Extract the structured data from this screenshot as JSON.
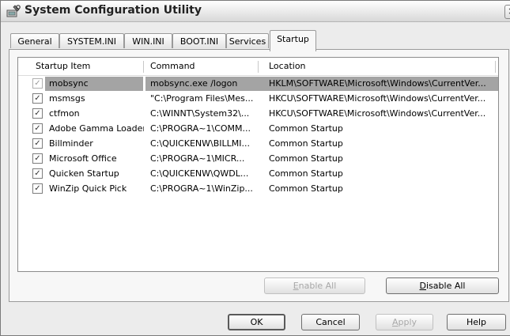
{
  "window": {
    "title": "System Configuration Utility",
    "close_glyph": "×",
    "icon": "config-utility-icon"
  },
  "tabs": [
    {
      "label": "General",
      "active": false
    },
    {
      "label": "SYSTEM.INI",
      "active": false
    },
    {
      "label": "WIN.INI",
      "active": false
    },
    {
      "label": "BOOT.INI",
      "active": false
    },
    {
      "label": "Services",
      "active": false
    },
    {
      "label": "Startup",
      "active": true
    }
  ],
  "list": {
    "columns": [
      "Startup Item",
      "Command",
      "Location"
    ],
    "rows": [
      {
        "item": "mobsync",
        "command": "mobsync.exe /logon",
        "location": "HKLM\\SOFTWARE\\Microsoft\\Windows\\CurrentVer...",
        "checked": true,
        "selected": true
      },
      {
        "item": "msmsgs",
        "command": "\"C:\\Program Files\\Mes...",
        "location": "HKCU\\SOFTWARE\\Microsoft\\Windows\\CurrentVer...",
        "checked": true,
        "selected": false
      },
      {
        "item": "ctfmon",
        "command": "C:\\WINNT\\System32\\...",
        "location": "HKCU\\SOFTWARE\\Microsoft\\Windows\\CurrentVer...",
        "checked": true,
        "selected": false
      },
      {
        "item": "Adobe Gamma Loader",
        "command": "C:\\PROGRA~1\\COMM...",
        "location": "Common Startup",
        "checked": true,
        "selected": false
      },
      {
        "item": "Billminder",
        "command": "C:\\QUICKENW\\BILLMI...",
        "location": "Common Startup",
        "checked": true,
        "selected": false
      },
      {
        "item": "Microsoft Office",
        "command": "C:\\PROGRA~1\\MICR...",
        "location": "Common Startup",
        "checked": true,
        "selected": false
      },
      {
        "item": "Quicken Startup",
        "command": "C:\\QUICKENW\\QWDL...",
        "location": "Common Startup",
        "checked": true,
        "selected": false
      },
      {
        "item": "WinZip Quick Pick",
        "command": "C:\\PROGRA~1\\WinZip...",
        "location": "Common Startup",
        "checked": true,
        "selected": false
      }
    ]
  },
  "panel_buttons": {
    "enable_all": {
      "pre": "",
      "key": "E",
      "post": "nable All",
      "enabled": false
    },
    "disable_all": {
      "pre": "",
      "key": "D",
      "post": "isable All",
      "enabled": true
    }
  },
  "dialog_buttons": {
    "ok": "OK",
    "cancel": "Cancel",
    "apply": {
      "pre": "",
      "key": "A",
      "post": "pply"
    },
    "help": "Help"
  },
  "check_glyph": "✓"
}
